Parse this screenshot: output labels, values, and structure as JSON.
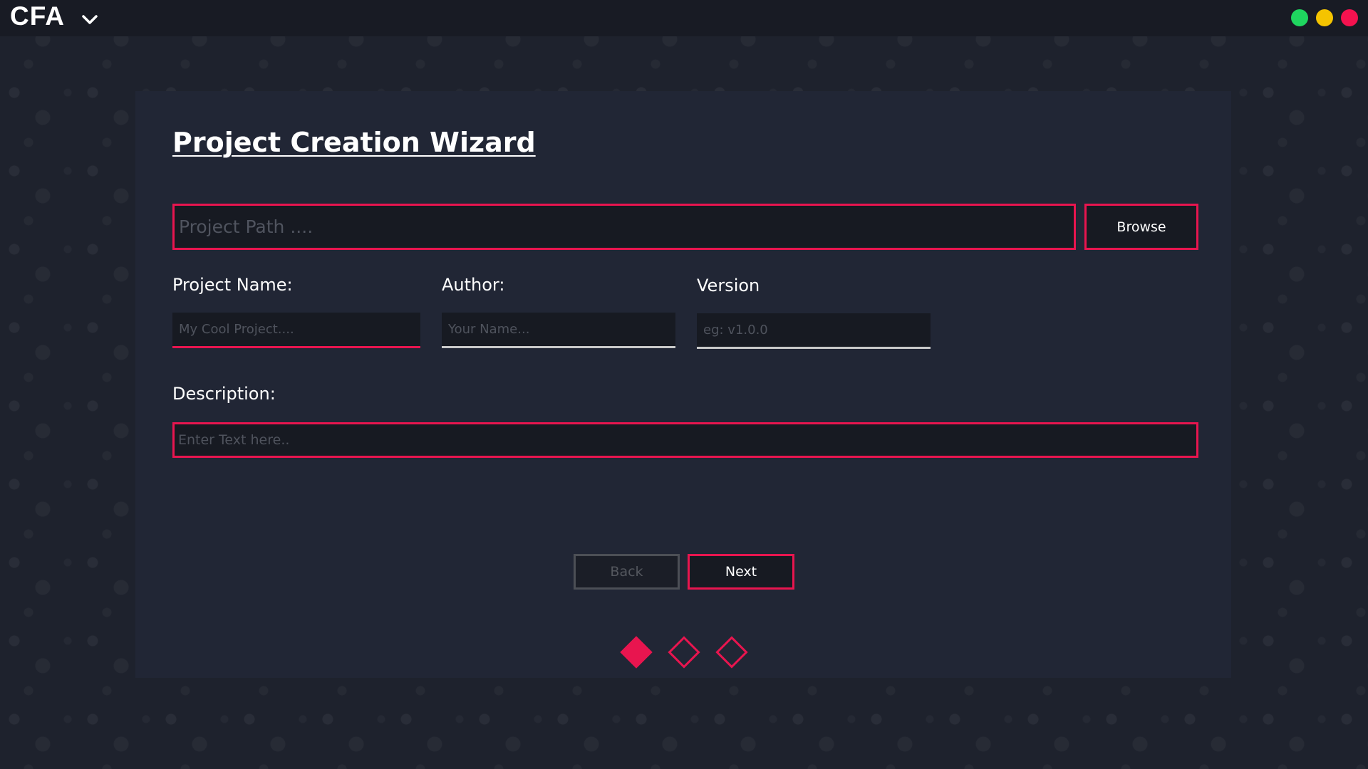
{
  "app": {
    "name": "CFA",
    "menu_icon": "chevron-down-icon"
  },
  "window_controls": {
    "maximize_color": "#1fd65f",
    "minimize_color": "#f5c400",
    "close_color": "#f5124f"
  },
  "wizard": {
    "title": "Project Creation Wizard",
    "path_placeholder": "Project Path ....",
    "browse_label": "Browse",
    "fields": {
      "project_name_label": "Project Name:",
      "project_name_placeholder": "My Cool Project....",
      "author_label": "Author:",
      "author_placeholder": "Your Name...",
      "version_label": "Version",
      "version_placeholder": "eg: v1.0.0"
    },
    "description_label": "Description:",
    "description_placeholder": "Enter Text here..",
    "back_label": "Back",
    "next_label": "Next",
    "steps": {
      "total": 3,
      "current": 1
    }
  },
  "colors": {
    "accent": "#e8154f",
    "panel": "#212635",
    "input_bg": "#171a22",
    "titlebar": "#181b24"
  }
}
